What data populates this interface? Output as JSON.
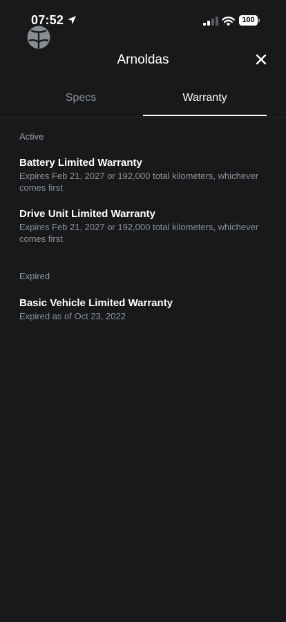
{
  "status_bar": {
    "time": "07:52",
    "battery": "100"
  },
  "header": {
    "title": "Arnoldas"
  },
  "tabs": [
    {
      "label": "Specs",
      "active": false
    },
    {
      "label": "Warranty",
      "active": true
    }
  ],
  "sections": [
    {
      "label": "Active",
      "items": [
        {
          "title": "Battery Limited Warranty",
          "description": "Expires Feb 21, 2027 or 192,000 total kilometers, whichever comes first"
        },
        {
          "title": "Drive Unit Limited Warranty",
          "description": "Expires Feb 21, 2027 or 192,000 total kilometers, whichever comes first"
        }
      ]
    },
    {
      "label": "Expired",
      "items": [
        {
          "title": "Basic Vehicle Limited Warranty",
          "description": "Expired as of Oct 23, 2022"
        }
      ]
    }
  ],
  "colors": {
    "background": "#17191b",
    "text_primary": "#ffffff",
    "text_secondary": "#8f9397"
  },
  "icons": [
    "location-arrow-icon",
    "signal-icon",
    "wifi-icon",
    "battery-icon",
    "app-logo-icon",
    "close-icon"
  ]
}
